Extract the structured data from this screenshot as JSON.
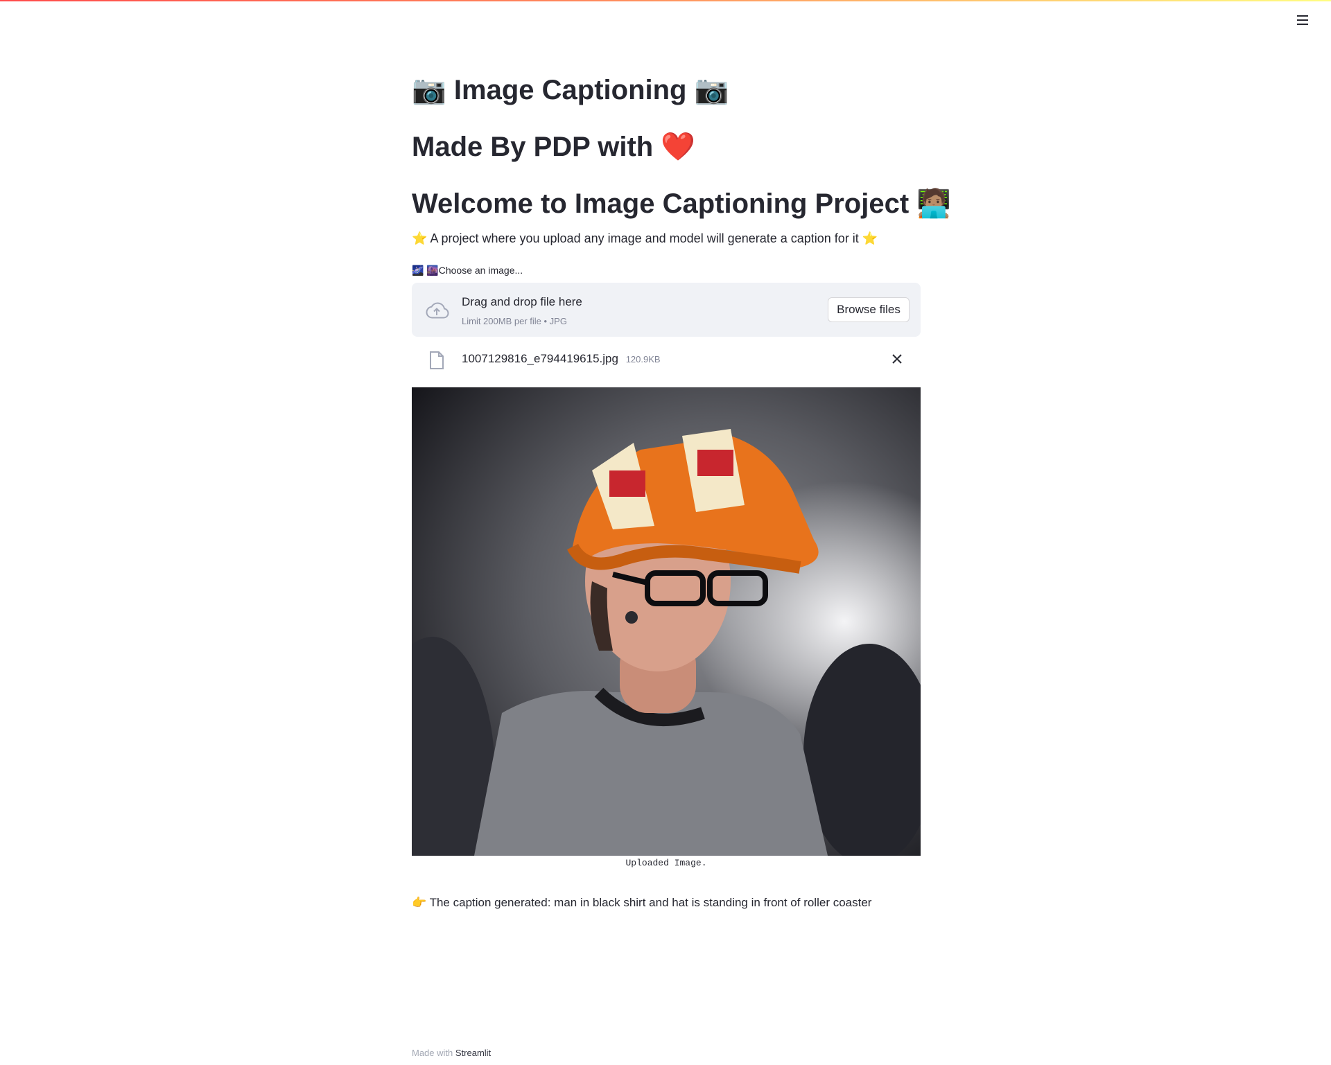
{
  "header": {
    "menu_icon": "hamburger-menu-icon"
  },
  "main": {
    "title": "📷 Image Captioning 📷",
    "subtitle_text": "Made By PDP with",
    "subtitle_emoji": "❤️",
    "welcome": "Welcome to Image Captioning Project 🧑🏽‍💻",
    "intro_text": "A project where you upload any image and model will generate a caption for it",
    "intro_star": "⭐",
    "uploader": {
      "label": "🌌 🌆Choose an image...",
      "drop_text": "Drag and drop file here",
      "limit_text": "Limit 200MB per file • JPG",
      "browse_label": "Browse files",
      "file_name": "1007129816_e794419615.jpg",
      "file_size": "120.9KB"
    },
    "image_caption": "Uploaded Image.",
    "result_emoji": "👉",
    "result_text": "The caption generated: man in black shirt and hat is standing in front of roller coaster"
  },
  "footer": {
    "prefix": "Made with",
    "link": "Streamlit"
  },
  "colors": {
    "accent_gradient_start": "#ff4b4b",
    "accent_gradient_end": "#fffd80",
    "text": "#262730",
    "dropzone_bg": "#f0f2f6",
    "muted": "#808495"
  }
}
